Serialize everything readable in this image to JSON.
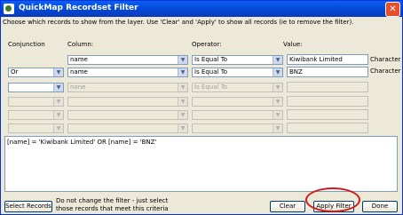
{
  "window": {
    "title": "QuickMap Recordset Filter",
    "close_glyph": "✕",
    "icon": "quickmap-app-icon"
  },
  "instructions": "Choose which records to show from the layer.  Use 'Clear' and 'Apply' to show all records (ie to remove the filter).",
  "columns": {
    "conjunction": "Conjunction",
    "column": "Column:",
    "operator": "Operator:",
    "value": "Value:"
  },
  "rows": [
    {
      "conjunction": "",
      "column": "name",
      "operator": "Is Equal To",
      "value": "Kiwibank Limited",
      "type": "Character"
    },
    {
      "conjunction": "Or",
      "column": "name",
      "operator": "Is Equal To",
      "value": "BNZ",
      "type": "Character"
    },
    {
      "conjunction": "",
      "column": "none",
      "operator": "Is Equal To",
      "value": "",
      "type": ""
    },
    {
      "conjunction": "",
      "column": "",
      "operator": "",
      "value": "",
      "type": ""
    },
    {
      "conjunction": "",
      "column": "",
      "operator": "",
      "value": "",
      "type": ""
    },
    {
      "conjunction": "",
      "column": "",
      "operator": "",
      "value": "",
      "type": ""
    }
  ],
  "expression": "[name] = 'Kiwibank Limited' OR [name] = 'BNZ'",
  "buttons": {
    "select_records": "Select Records",
    "clear": "Clear",
    "apply_filter": "Apply Filter",
    "done": "Done"
  },
  "select_note": {
    "line1": "Do not change the filter - just select",
    "line2": "those records that meet this criteria"
  },
  "colors": {
    "titlebar": "#0a5ff2",
    "highlight_circle": "#d01818"
  }
}
